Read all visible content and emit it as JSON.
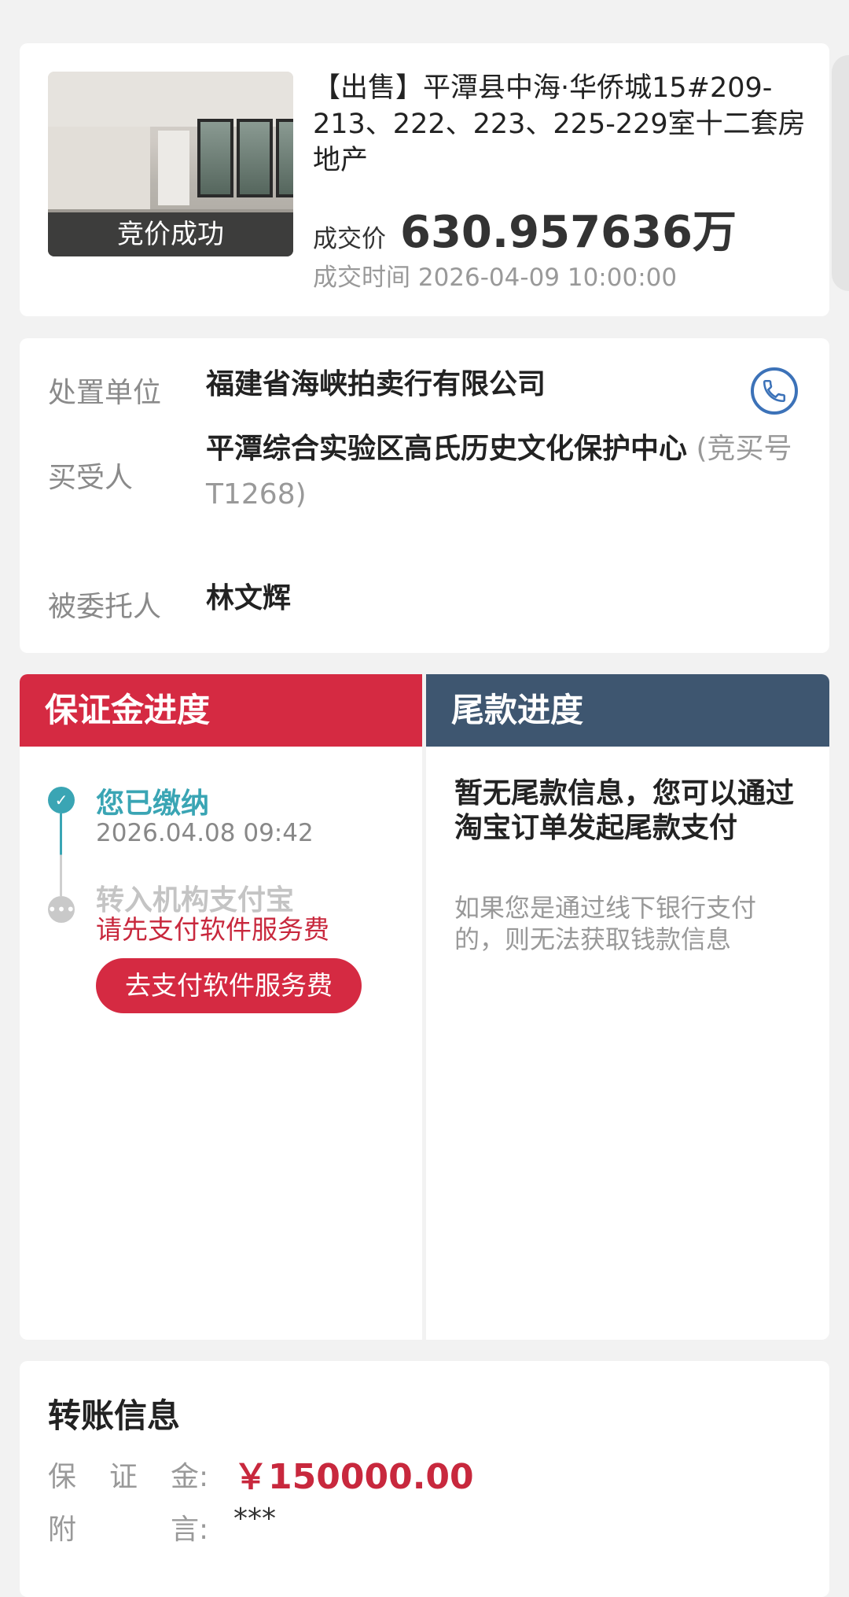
{
  "product": {
    "thumb_badge": "竞价成功",
    "title": "【出售】平潭县中海·华侨城15#209-213、222、223、225-229室十二套房地产",
    "price_label": "成交价",
    "price_value": "630.957636万",
    "deal_time": "成交时间 2026-04-09 10:00:00"
  },
  "party": {
    "disposer_label": "处置单位",
    "disposer_value": "福建省海峡拍卖行有限公司",
    "buyer_label": "买受人",
    "buyer_value": "平潭综合实验区高氏历史文化保护中心",
    "buyer_sub": " (竞买号 T1268)",
    "agent_label": "被委托人",
    "agent_value": "林文辉",
    "phone_icon": "phone-icon"
  },
  "deposit": {
    "header": "保证金进度",
    "step1_title": "您已缴纳",
    "step1_time": "2026.04.08 09:42",
    "step2_title": "转入机构支付宝",
    "step2_warn": "请先支付软件服务费",
    "pay_button": "去支付软件服务费",
    "colors": {
      "primary": "#d52a42",
      "done": "#3aa5b4"
    }
  },
  "balance": {
    "header": "尾款进度",
    "main_text": "暂无尾款信息，您可以通过淘宝订单发起尾款支付",
    "note": "如果您是通过线下银行支付的，则无法获取钱款信息",
    "colors": {
      "header_bg": "#3e5670"
    }
  },
  "transfer": {
    "title": "转账信息",
    "deposit_label_chars": [
      "保",
      "证",
      "金:"
    ],
    "deposit_amount": "￥150000.00",
    "remark_label_chars": [
      "附",
      "",
      "言:"
    ],
    "remark_value": "***"
  }
}
